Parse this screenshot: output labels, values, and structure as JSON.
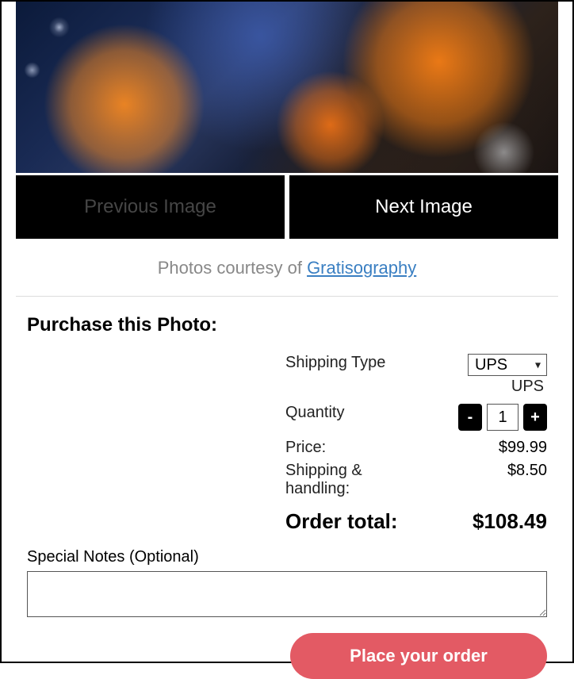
{
  "nav": {
    "prev_label": "Previous Image",
    "next_label": "Next Image"
  },
  "credit": {
    "prefix": "Photos courtesy of ",
    "link_text": "Gratisography"
  },
  "purchase": {
    "title": "Purchase this Photo:",
    "shipping_label": "Shipping Type",
    "shipping_selected": "UPS",
    "shipping_hint": "UPS",
    "quantity_label": "Quantity",
    "quantity_value": "1",
    "minus": "-",
    "plus": "+",
    "price_label": "Price:",
    "price_value": "$99.99",
    "ship_handling_label": "Shipping & handling:",
    "ship_handling_value": "$8.50",
    "total_label": "Order total:",
    "total_value": "$108.49",
    "notes_label": "Special Notes (Optional)",
    "notes_value": "",
    "place_order_label": "Place your order"
  }
}
